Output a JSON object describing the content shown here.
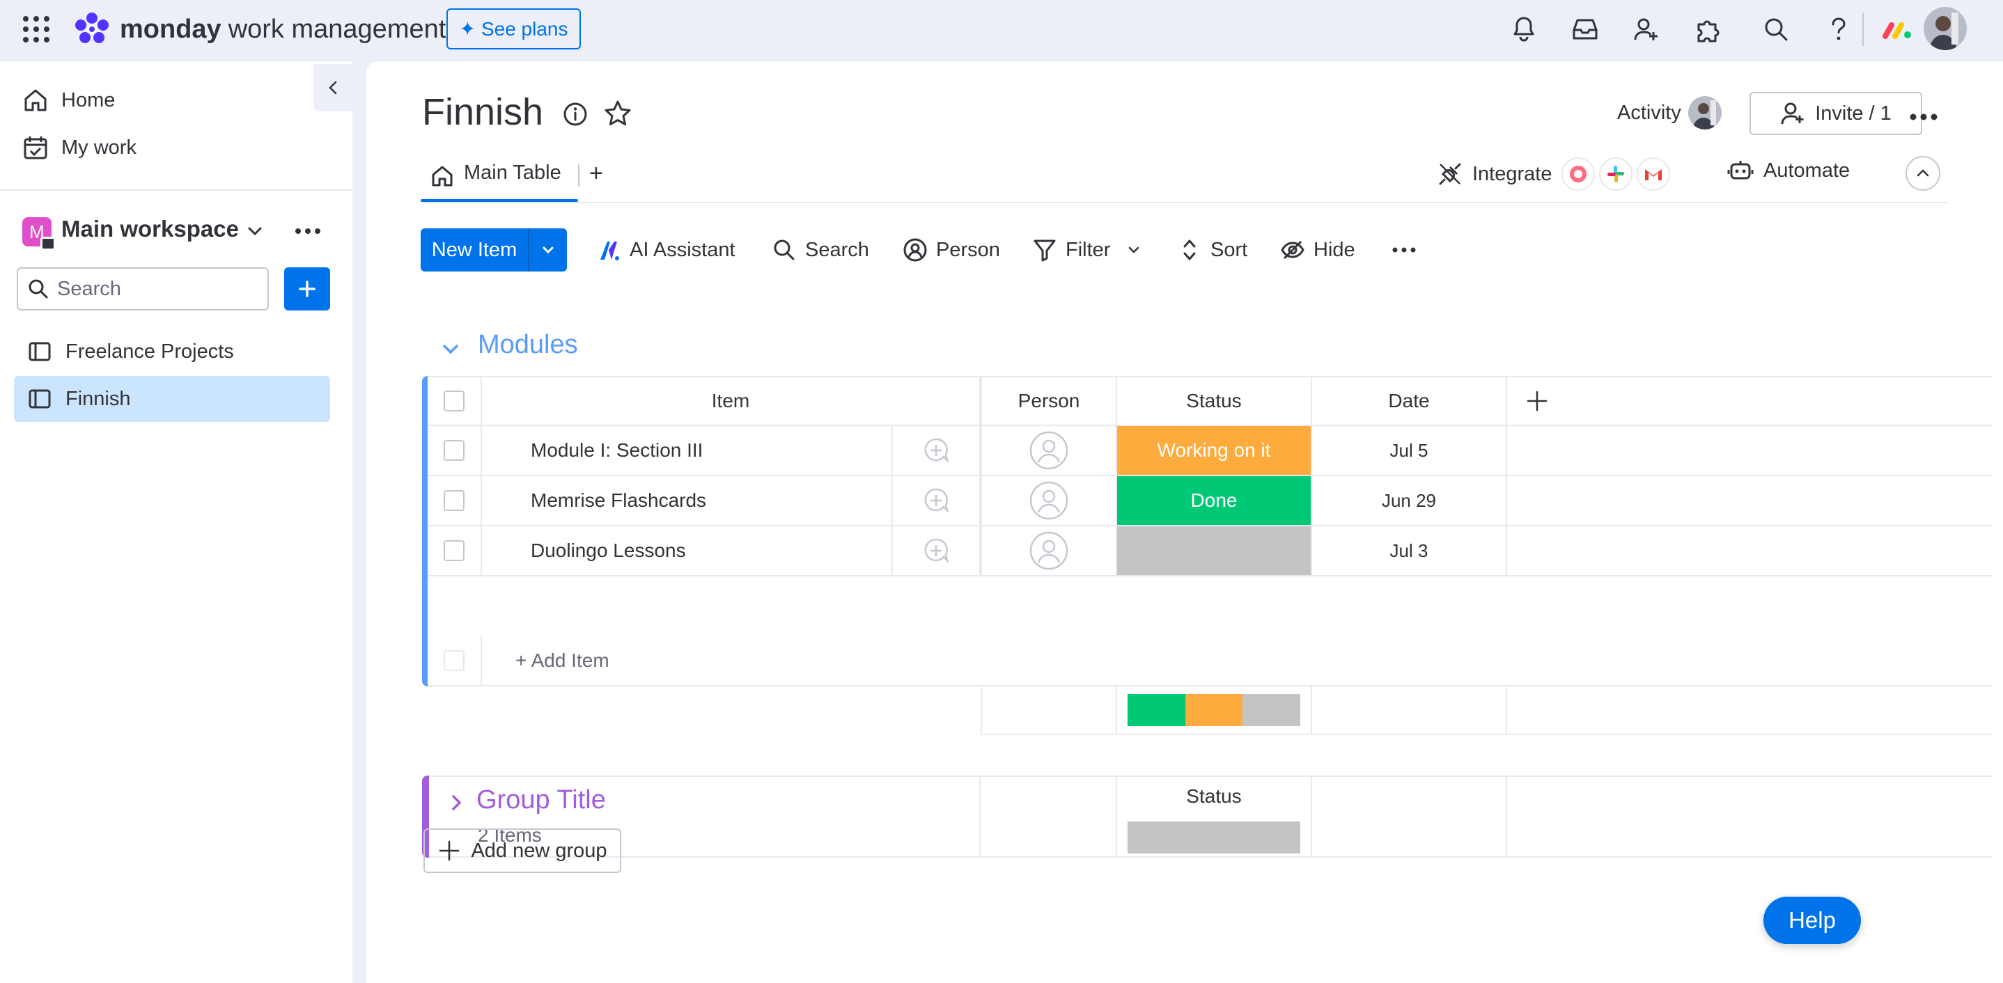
{
  "app": {
    "brand": "monday",
    "product": "work management",
    "see_plans": "See plans"
  },
  "sidebar": {
    "home": "Home",
    "my_work": "My work",
    "workspace_initial": "M",
    "workspace_name": "Main workspace",
    "search_placeholder": "Search",
    "boards": [
      {
        "label": "Freelance Projects",
        "active": false
      },
      {
        "label": "Finnish",
        "active": true
      }
    ]
  },
  "board": {
    "title": "Finnish",
    "activity": "Activity",
    "invite": "Invite / 1",
    "tabs": [
      {
        "label": "Main Table",
        "active": true
      }
    ],
    "integrate": "Integrate",
    "automate": "Automate"
  },
  "toolbar": {
    "new_item": "New Item",
    "ai_assistant": "AI Assistant",
    "search": "Search",
    "person": "Person",
    "filter": "Filter",
    "sort": "Sort",
    "hide": "Hide"
  },
  "groups": [
    {
      "title": "Modules",
      "color": "#579bfc",
      "expanded": true,
      "columns": {
        "item": "Item",
        "person": "Person",
        "status": "Status",
        "date": "Date"
      },
      "rows": [
        {
          "name": "Module I: Section III",
          "status": "Working on it",
          "status_color": "#fdab3d",
          "date": "Jul 5"
        },
        {
          "name": "Memrise Flashcards",
          "status": "Done",
          "status_color": "#00c875",
          "date": "Jun 29"
        },
        {
          "name": "Duolingo Lessons",
          "status": "",
          "status_color": "#c4c4c4",
          "date": "Jul 3"
        }
      ],
      "add_item": "+ Add Item",
      "status_summary": [
        {
          "label": "Done",
          "fraction": 0.3333,
          "color": "#00c875"
        },
        {
          "label": "Working on it",
          "fraction": 0.3333,
          "color": "#fdab3d"
        },
        {
          "label": "",
          "fraction": 0.3334,
          "color": "#c4c4c4"
        }
      ]
    },
    {
      "title": "Group Title",
      "color": "#a25ddc",
      "expanded": false,
      "count_label": "2 Items",
      "status_header": "Status"
    }
  ],
  "add_new_group": "Add new group",
  "help": "Help"
}
